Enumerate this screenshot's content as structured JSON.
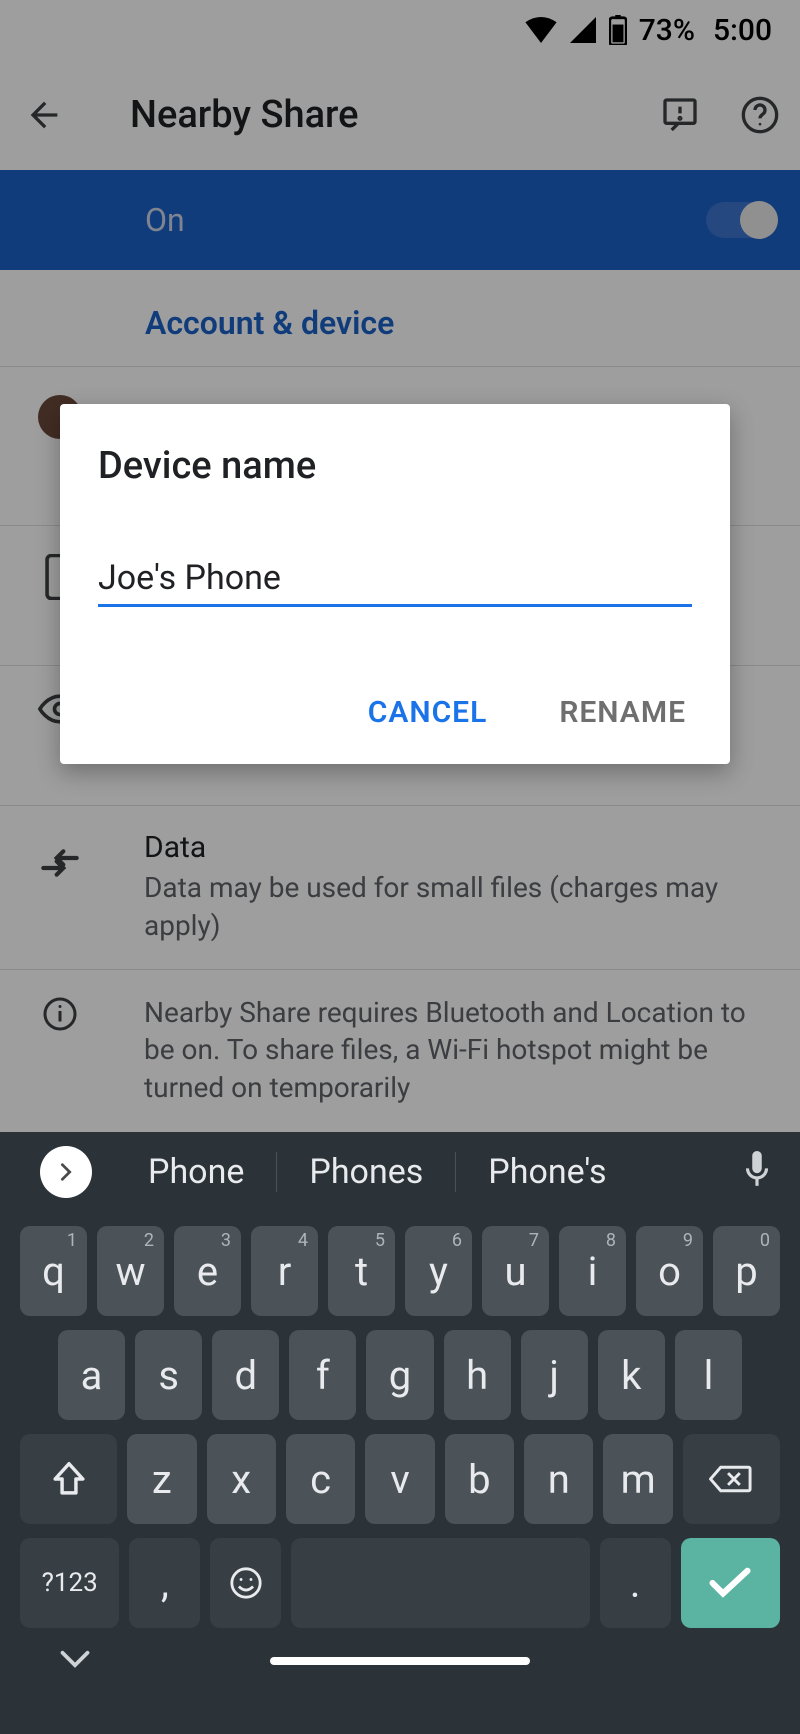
{
  "status": {
    "battery": "73%",
    "time": "5:00"
  },
  "header": {
    "title": "Nearby Share"
  },
  "banner": {
    "label": "On"
  },
  "section": {
    "title": "Account & device"
  },
  "items": {
    "data": {
      "title": "Data",
      "subtitle": "Data may be used for small files (charges may apply)"
    },
    "info": {
      "text": "Nearby Share requires Bluetooth and Location to be on. To share files, a Wi-Fi hotspot might be turned on temporarily"
    }
  },
  "dialog": {
    "title": "Device name",
    "value": "Joe's Phone",
    "cancel": "CANCEL",
    "rename": "RENAME"
  },
  "keyboard": {
    "suggestions": [
      "Phone",
      "Phones",
      "Phone's"
    ],
    "row1": [
      {
        "k": "q",
        "n": "1"
      },
      {
        "k": "w",
        "n": "2"
      },
      {
        "k": "e",
        "n": "3"
      },
      {
        "k": "r",
        "n": "4"
      },
      {
        "k": "t",
        "n": "5"
      },
      {
        "k": "y",
        "n": "6"
      },
      {
        "k": "u",
        "n": "7"
      },
      {
        "k": "i",
        "n": "8"
      },
      {
        "k": "o",
        "n": "9"
      },
      {
        "k": "p",
        "n": "0"
      }
    ],
    "row2": [
      "a",
      "s",
      "d",
      "f",
      "g",
      "h",
      "j",
      "k",
      "l"
    ],
    "row3": [
      "z",
      "x",
      "c",
      "v",
      "b",
      "n",
      "m"
    ],
    "symkey": "?123",
    "comma": ",",
    "period": "."
  }
}
